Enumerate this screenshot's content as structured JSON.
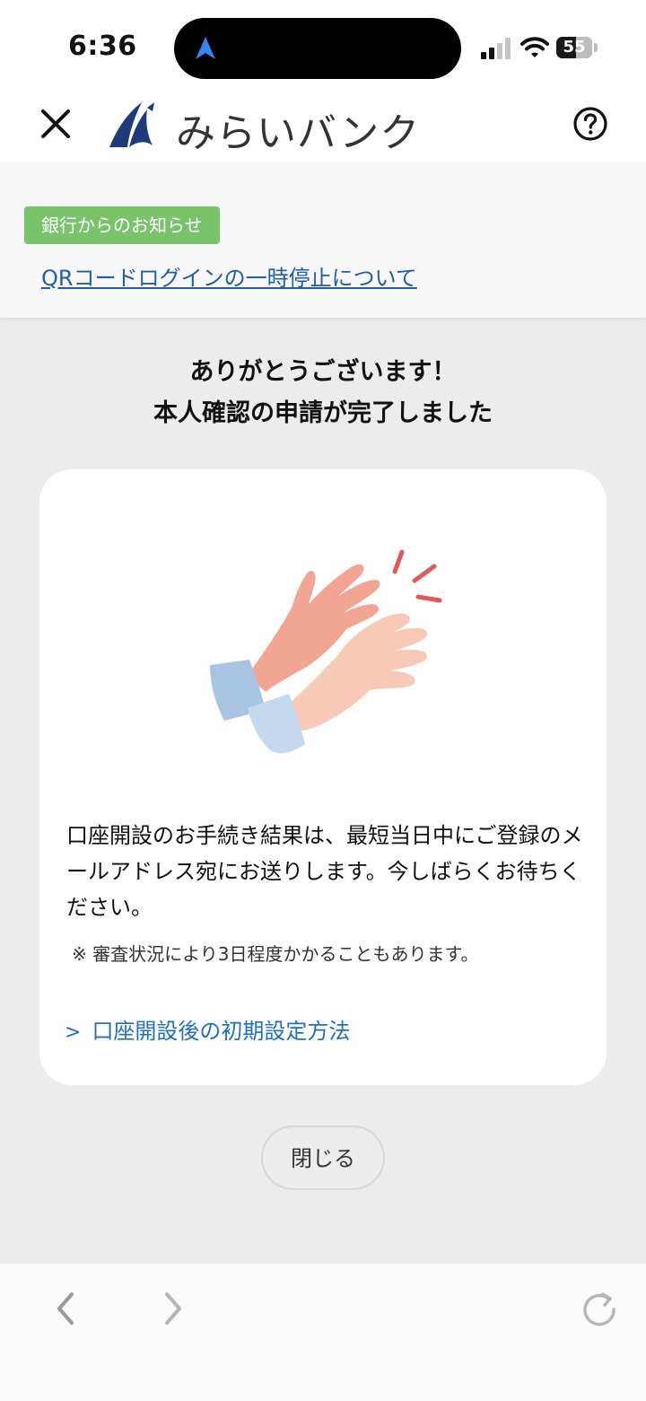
{
  "status_bar": {
    "time": "6:36",
    "battery_level": "55",
    "battery_percent": 55
  },
  "header": {
    "brand_name": "みらいバンク",
    "close_icon": "close-icon",
    "help_icon": "help-icon",
    "logo_color": "#1e3a7a"
  },
  "notice": {
    "badge": "銀行からのお知らせ",
    "link_text": "QRコードログインの一時停止について",
    "badge_color": "#79c36b",
    "link_color": "#1f5fa8"
  },
  "main": {
    "title_line1": "ありがとうございます！",
    "title_line2": "本人確認の申請が完了しました",
    "card": {
      "body": "口座開設のお手続き結果は、最短当日中にご登録のメールアドレス宛にお送りします。今しばらくお待ちください。",
      "note": "※ 審査状況により3日程度かかることもあります。",
      "link_chevron": ">",
      "link_text": "口座開設後の初期設定方法",
      "illustration": "clapping-hands-illustration"
    },
    "close_button": "閉じる"
  },
  "browser_bar": {
    "back_icon": "back-arrow-icon",
    "forward_icon": "forward-arrow-icon",
    "reload_icon": "reload-icon"
  }
}
